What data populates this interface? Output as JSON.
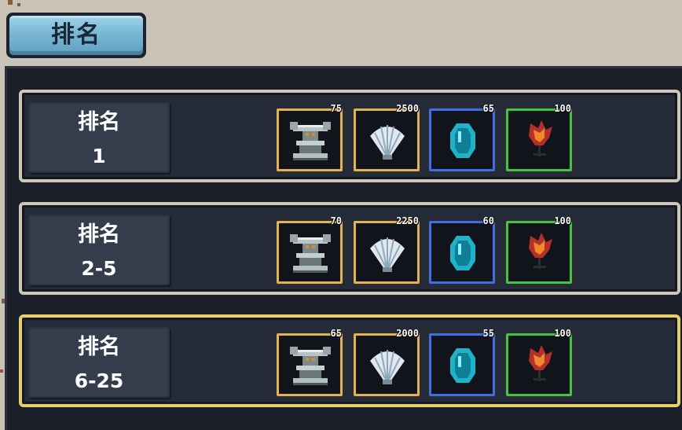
{
  "tab": {
    "label": "排名"
  },
  "rows": [
    {
      "title": "排名",
      "rank": "1",
      "rewards": [
        {
          "icon": "anvil-icon",
          "qty": "75"
        },
        {
          "icon": "shell-icon",
          "qty": "2500"
        },
        {
          "icon": "gem-icon",
          "qty": "65"
        },
        {
          "icon": "flame-flower-icon",
          "qty": "100"
        }
      ]
    },
    {
      "title": "排名",
      "rank": "2-5",
      "rewards": [
        {
          "icon": "anvil-icon",
          "qty": "70"
        },
        {
          "icon": "shell-icon",
          "qty": "2250"
        },
        {
          "icon": "gem-icon",
          "qty": "60"
        },
        {
          "icon": "flame-flower-icon",
          "qty": "100"
        }
      ]
    },
    {
      "title": "排名",
      "rank": "6-25",
      "rewards": [
        {
          "icon": "anvil-icon",
          "qty": "65"
        },
        {
          "icon": "shell-icon",
          "qty": "2000"
        },
        {
          "icon": "gem-icon",
          "qty": "55"
        },
        {
          "icon": "flame-flower-icon",
          "qty": "100"
        }
      ]
    }
  ],
  "colors": {
    "slot_gold": "#e0b455",
    "slot_blue": "#3d6fe6",
    "slot_green": "#45c24a",
    "row_highlight": "#e7cf6c"
  }
}
